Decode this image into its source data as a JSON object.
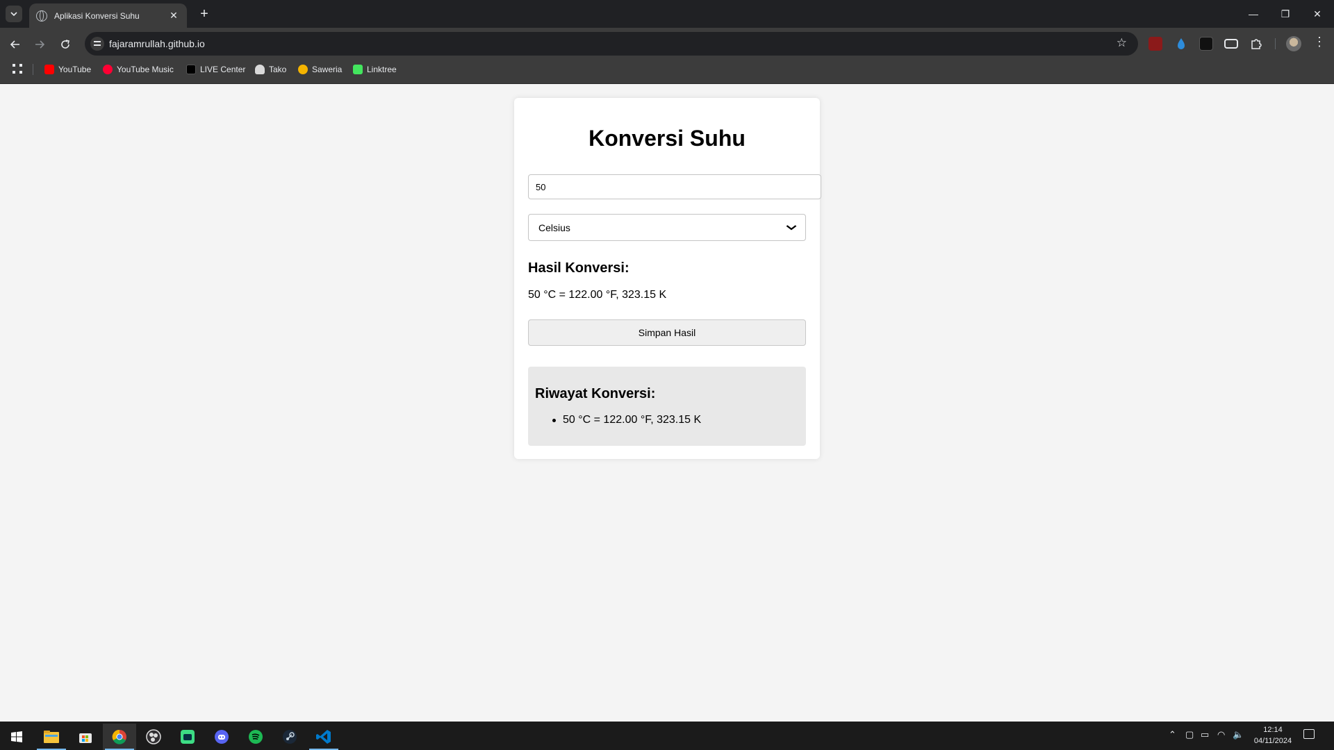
{
  "browser": {
    "tab_title": "Aplikasi Konversi Suhu",
    "tab_close": "✕",
    "new_tab": "+",
    "url": "fajaramrullah.github.io",
    "window_controls": {
      "minimize": "—",
      "restore": "❐",
      "close": "✕"
    },
    "bookmarks": [
      {
        "label": "YouTube",
        "icon": "youtube-icon",
        "color": "#ff0000"
      },
      {
        "label": "YouTube Music",
        "icon": "youtube-music-icon",
        "color": "#ff0033"
      },
      {
        "label": "LIVE Center",
        "icon": "tiktok-icon",
        "color": "#000000"
      },
      {
        "label": "Tako",
        "icon": "tako-icon",
        "color": "#d9d9d9"
      },
      {
        "label": "Saweria",
        "icon": "saweria-icon",
        "color": "#f5b400"
      },
      {
        "label": "Linktree",
        "icon": "linktree-icon",
        "color": "#43e55e"
      }
    ]
  },
  "app": {
    "title": "Konversi Suhu",
    "input_value": "50",
    "unit_selected": "Celsius",
    "result_title": "Hasil Konversi:",
    "result_text": "50 °C = 122.00 °F, 323.15 K",
    "save_button": "Simpan Hasil",
    "history_title": "Riwayat Konversi:",
    "history": [
      "50 °C = 122.00 °F, 323.15 K"
    ]
  },
  "taskbar": {
    "apps": [
      "start-icon",
      "file-explorer-icon",
      "microsoft-store-icon",
      "chrome-icon",
      "obs-icon",
      "android-studio-icon",
      "discord-icon",
      "spotify-icon",
      "steam-icon",
      "vscode-icon"
    ],
    "time": "12:14",
    "date": "04/11/2024"
  }
}
